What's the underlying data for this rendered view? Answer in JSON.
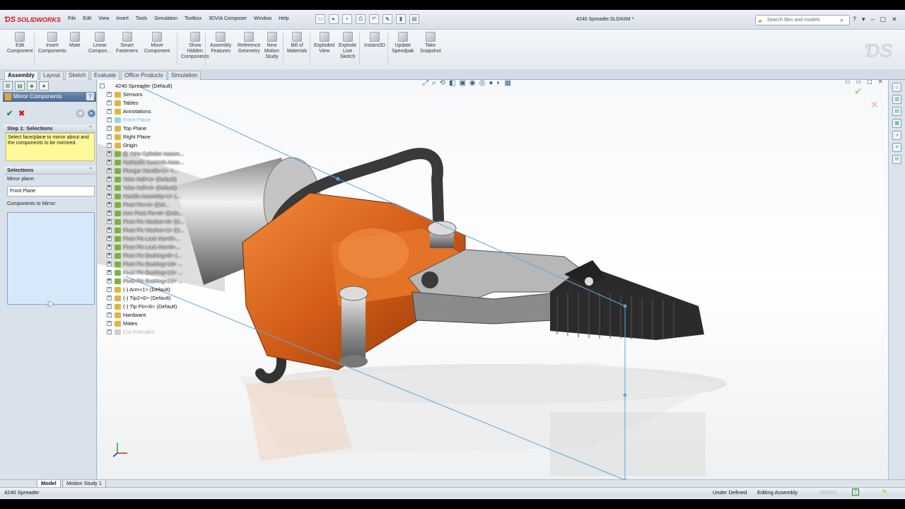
{
  "app": {
    "logo": "SOLIDWORKS",
    "doc_title": "4240 Spreader.SLDASM *"
  },
  "menu": [
    "File",
    "Edit",
    "View",
    "Insert",
    "Tools",
    "Simulation",
    "Toolbox",
    "3DVIA Composer",
    "Window",
    "Help"
  ],
  "search": {
    "placeholder": "Search files and models"
  },
  "ribbon": [
    {
      "label": "Edit\nComponent"
    },
    {
      "label": "Insert\nComponents"
    },
    {
      "label": "Mate"
    },
    {
      "label": "Linear\nCompon..."
    },
    {
      "label": "Smart\nFasteners"
    },
    {
      "label": "Move\nComponent"
    },
    {
      "label": "Show\nHidden\nComponents"
    },
    {
      "label": "Assembly\nFeatures"
    },
    {
      "label": "Reference\nGeometry"
    },
    {
      "label": "New\nMotion\nStudy"
    },
    {
      "label": "Bill of\nMaterials"
    },
    {
      "label": "Exploded\nView"
    },
    {
      "label": "Explode\nLine\nSketch"
    },
    {
      "label": "Instant3D"
    },
    {
      "label": "Update\nSpeedpak"
    },
    {
      "label": "Take\nSnapshot"
    }
  ],
  "tabs": [
    "Assembly",
    "Layout",
    "Sketch",
    "Evaluate",
    "Office Products",
    "Simulation"
  ],
  "property_manager": {
    "title": "Mirror Components",
    "help": "?",
    "step1_header": "Step 1: Selections",
    "step1_note": "Select face/plane to mirror about and the components to be mirrored.",
    "selections_header": "Selections",
    "mirror_plane_label": "Mirror plane:",
    "mirror_plane_value": "Front Plane",
    "components_label": "Components to Mirror:"
  },
  "tree": {
    "root": "4240 Spreader  (Default)",
    "items": [
      {
        "label": "Sensors",
        "style": ""
      },
      {
        "label": "Tables",
        "style": ""
      },
      {
        "label": "Annotations",
        "style": ""
      },
      {
        "label": "Front Plane",
        "style": "sel"
      },
      {
        "label": "Top Plane",
        "style": ""
      },
      {
        "label": "Right Plane",
        "style": ""
      },
      {
        "label": "Origin",
        "style": ""
      },
      {
        "label": "(f) Yoke Cylinder Assem...",
        "style": "ov"
      },
      {
        "label": "Hydraulic Controls Asse...",
        "style": "ov"
      },
      {
        "label": "Plunger Handle<1> <...",
        "style": "ov"
      },
      {
        "label": "Yoke Half<1> (Default)",
        "style": "ov"
      },
      {
        "label": "Yoke Half<4> (Default)",
        "style": "ov"
      },
      {
        "label": "Handle Assembly<1> (...",
        "style": "ov"
      },
      {
        "label": "Pivot Pin<4> (Def...",
        "style": "ov"
      },
      {
        "label": "Arm Pivot Pin<6> (Defa...",
        "style": "ov"
      },
      {
        "label": "Pivot Pin Washer<6> (D...",
        "style": "ov"
      },
      {
        "label": "Pivot Pin Washer<1> (D...",
        "style": "ov"
      },
      {
        "label": "Pivot Pin Lock Nut<5>...",
        "style": "ov"
      },
      {
        "label": "Pivot Pin Lock Nut<6>...",
        "style": "ov"
      },
      {
        "label": "Pivot Pin Bushing<9> (...",
        "style": "ov"
      },
      {
        "label": "Pivot Pin Bushing<10> ...",
        "style": "ov"
      },
      {
        "label": "Pivot Pin Bushing<13> ...",
        "style": "ov"
      },
      {
        "label": "Pivot Pin Bushing<14> ...",
        "style": "ov"
      },
      {
        "label": "(-) Arm<1> (Default)",
        "style": ""
      },
      {
        "label": "(-) Tip2<6> (Default)",
        "style": ""
      },
      {
        "label": "(-) Tip Pin<6> (Default)",
        "style": ""
      },
      {
        "label": "Hardware",
        "style": ""
      },
      {
        "label": "Mates",
        "style": ""
      },
      {
        "label": "Cut-Extrude2",
        "style": "dim"
      }
    ]
  },
  "bottom_tabs": [
    "Model",
    "Motion Study 1"
  ],
  "status": {
    "left": "4240 Spreader",
    "defined": "Under Defined",
    "mode": "Editing Assembly",
    "units": "MMGS"
  },
  "colors": {
    "orange": "#d9621b",
    "accent": "#4a6f98",
    "selection": "#68c6e0"
  }
}
